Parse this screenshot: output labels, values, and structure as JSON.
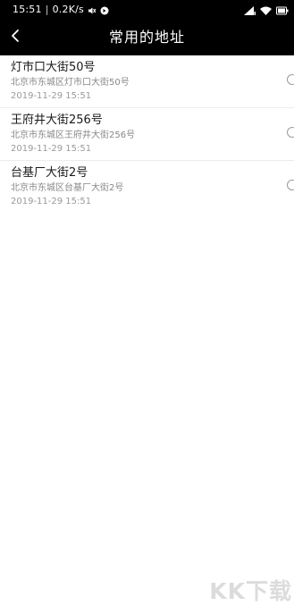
{
  "status_bar": {
    "time": "15:51",
    "network_speed": "0.2K/s",
    "icons": [
      "mute-icon",
      "notification-icon",
      "sim-signal-icon",
      "wifi-icon",
      "battery-icon"
    ]
  },
  "header": {
    "back_icon": "chevron-left-icon",
    "title": "常用的地址"
  },
  "addresses": [
    {
      "name": "灯市口大街50号",
      "detail": "北京市东城区灯市口大街50号",
      "time": "2019-11-29 15:51",
      "selected": false
    },
    {
      "name": "王府井大街256号",
      "detail": "北京市东城区王府井大街256号",
      "time": "2019-11-29 15:51",
      "selected": false
    },
    {
      "name": "台基厂大街2号",
      "detail": "北京市东城区台基厂大街2号",
      "time": "2019-11-29 15:51",
      "selected": false
    }
  ],
  "watermark": "KK下载",
  "colors": {
    "header_bg": "#000000",
    "header_text": "#ffffff",
    "name_text": "#1a1a1a",
    "detail_text": "#888888",
    "divider": "#ececec"
  }
}
